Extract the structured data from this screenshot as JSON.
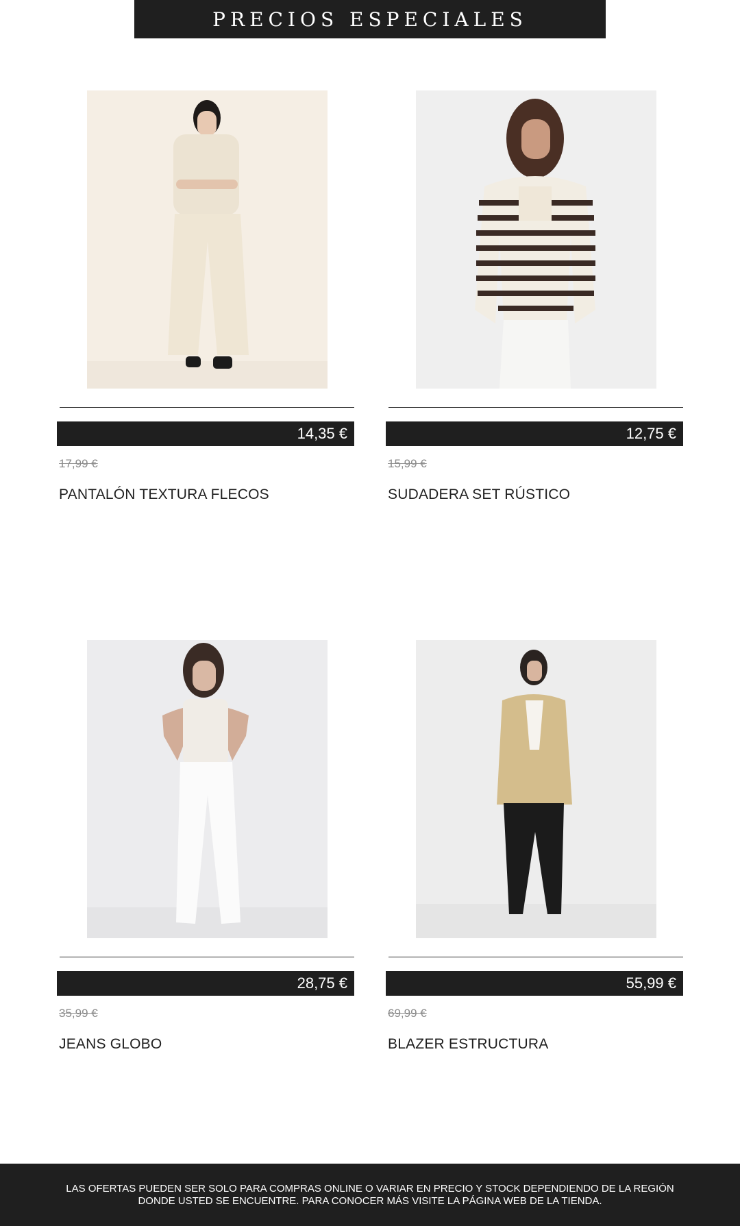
{
  "banner": {
    "title": "PRECIOS ESPECIALES"
  },
  "products": [
    {
      "price": "14,35 €",
      "old_price": "17,99 €",
      "name": "PANTALÓN TEXTURA FLECOS"
    },
    {
      "price": "12,75 €",
      "old_price": "15,99 €",
      "name": "SUDADERA SET RÚSTICO"
    },
    {
      "price": "28,75 €",
      "old_price": "35,99 €",
      "name": "JEANS GLOBO"
    },
    {
      "price": "55,99 €",
      "old_price": "69,99 €",
      "name": "BLAZER ESTRUCTURA"
    }
  ],
  "footer": {
    "line1": "LAS OFERTAS PUEDEN SER SOLO PARA COMPRAS ONLINE O VARIAR EN PRECIO Y STOCK DEPENDIENDO DE LA REGIÓN",
    "line2": "DONDE USTED SE ENCUENTRE. PARA CONOCER MÁS VISITE LA PÁGINA WEB DE LA TIENDA."
  }
}
